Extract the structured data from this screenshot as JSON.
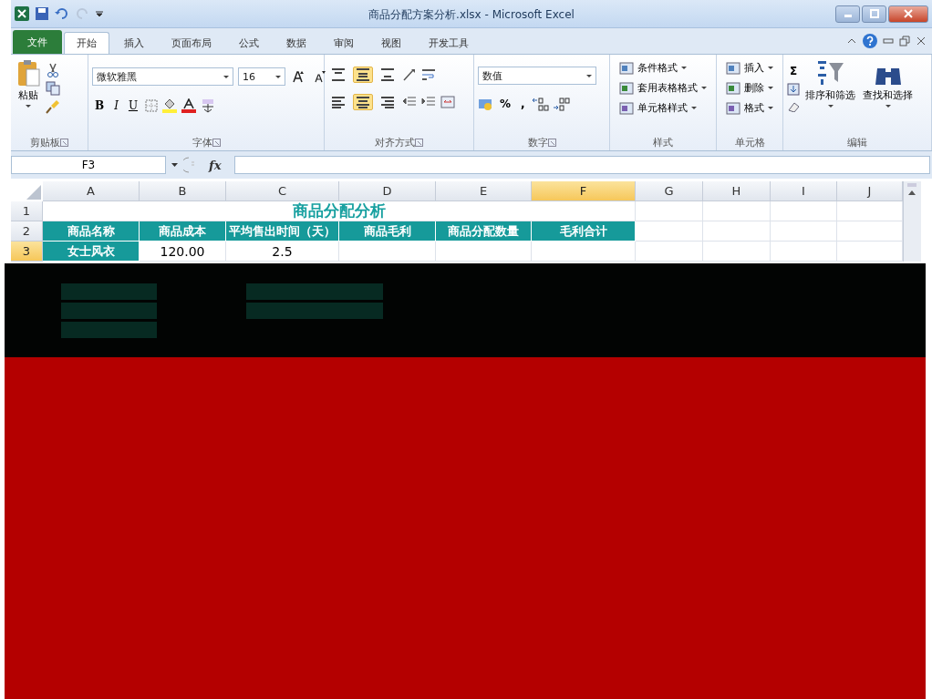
{
  "window": {
    "title": "商品分配方案分析.xlsx - Microsoft Excel"
  },
  "tabs": [
    {
      "label": "文件",
      "kind": "file",
      "selected": false
    },
    {
      "label": "开始",
      "kind": "tab",
      "selected": true
    },
    {
      "label": "插入",
      "kind": "tab",
      "selected": false
    },
    {
      "label": "页面布局",
      "kind": "tab",
      "selected": false
    },
    {
      "label": "公式",
      "kind": "tab",
      "selected": false
    },
    {
      "label": "数据",
      "kind": "tab",
      "selected": false
    },
    {
      "label": "审阅",
      "kind": "tab",
      "selected": false
    },
    {
      "label": "视图",
      "kind": "tab",
      "selected": false
    },
    {
      "label": "开发工具",
      "kind": "tab",
      "selected": false
    }
  ],
  "ribbon": {
    "groups": [
      {
        "kind": "clipboard",
        "label": "剪贴板",
        "paste": "粘贴"
      },
      {
        "kind": "font",
        "label": "字体",
        "font": "微软雅黑",
        "size": "16",
        "styles": [
          "B",
          "I",
          "U"
        ]
      },
      {
        "kind": "align",
        "label": "对齐方式",
        "vertical": [
          {
            "selected": false
          },
          {
            "selected": true
          },
          {
            "selected": false
          }
        ],
        "horizontal": [
          {
            "selected": false
          },
          {
            "selected": true
          },
          {
            "selected": false
          }
        ]
      },
      {
        "kind": "number",
        "label": "数字",
        "format": "数值",
        "symbols": [
          "%",
          ","
        ]
      },
      {
        "kind": "list",
        "label": "样式",
        "items": [
          "条件格式",
          "套用表格格式",
          "单元格样式"
        ]
      },
      {
        "kind": "list",
        "label": "单元格",
        "items": [
          "插入",
          "删除",
          "格式"
        ]
      },
      {
        "kind": "edit",
        "label": "编辑",
        "sum": "Σ",
        "items": [
          "排序和筛选",
          "查找和选择"
        ]
      }
    ]
  },
  "formula_bar": {
    "name_box": "F3",
    "fx": "fx"
  },
  "sheet": {
    "columns": [
      {
        "label": "A",
        "selected": false
      },
      {
        "label": "B",
        "selected": false
      },
      {
        "label": "C",
        "selected": false
      },
      {
        "label": "D",
        "selected": false
      },
      {
        "label": "E",
        "selected": false
      },
      {
        "label": "F",
        "selected": true
      },
      {
        "label": "G",
        "selected": false
      },
      {
        "label": "H",
        "selected": false
      },
      {
        "label": "I",
        "selected": false
      },
      {
        "label": "J",
        "selected": false
      }
    ],
    "title": "商品分配分析",
    "headers": [
      "商品名称",
      "商品成本",
      "平均售出时间（天）",
      "商品毛利",
      "商品分配数量",
      "毛利合计"
    ],
    "rows": [
      {
        "number": "1",
        "selected": false
      },
      {
        "number": "2",
        "selected": false
      },
      {
        "number": "3",
        "selected": true
      }
    ],
    "row_3": [
      "女士风衣",
      "120.00",
      "2.5"
    ]
  }
}
